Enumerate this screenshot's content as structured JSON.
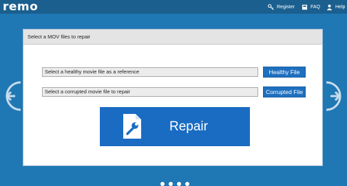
{
  "app": {
    "logo": "remo"
  },
  "top_nav": {
    "register": "Register",
    "faq": "FAQ",
    "help": "Help"
  },
  "panel": {
    "title": "Select a MOV files to repair",
    "healthy_field_value": "Select a healthy movie file as a reference",
    "healthy_button": "Healthy File",
    "corrupted_field_value": "Select a corrupted movie file to repair",
    "corrupted_button": "Corrupted File",
    "repair_button": "Repair"
  },
  "icons": {
    "register": "key-icon",
    "faq": "book-icon",
    "help": "person-icon",
    "back": "arrow-left-icon",
    "forward": "arrow-right-icon",
    "repair": "document-wrench-icon"
  },
  "colors": {
    "background": "#1f78b4",
    "topbar": "#1b5f8f",
    "accent": "#1a6cc2"
  }
}
